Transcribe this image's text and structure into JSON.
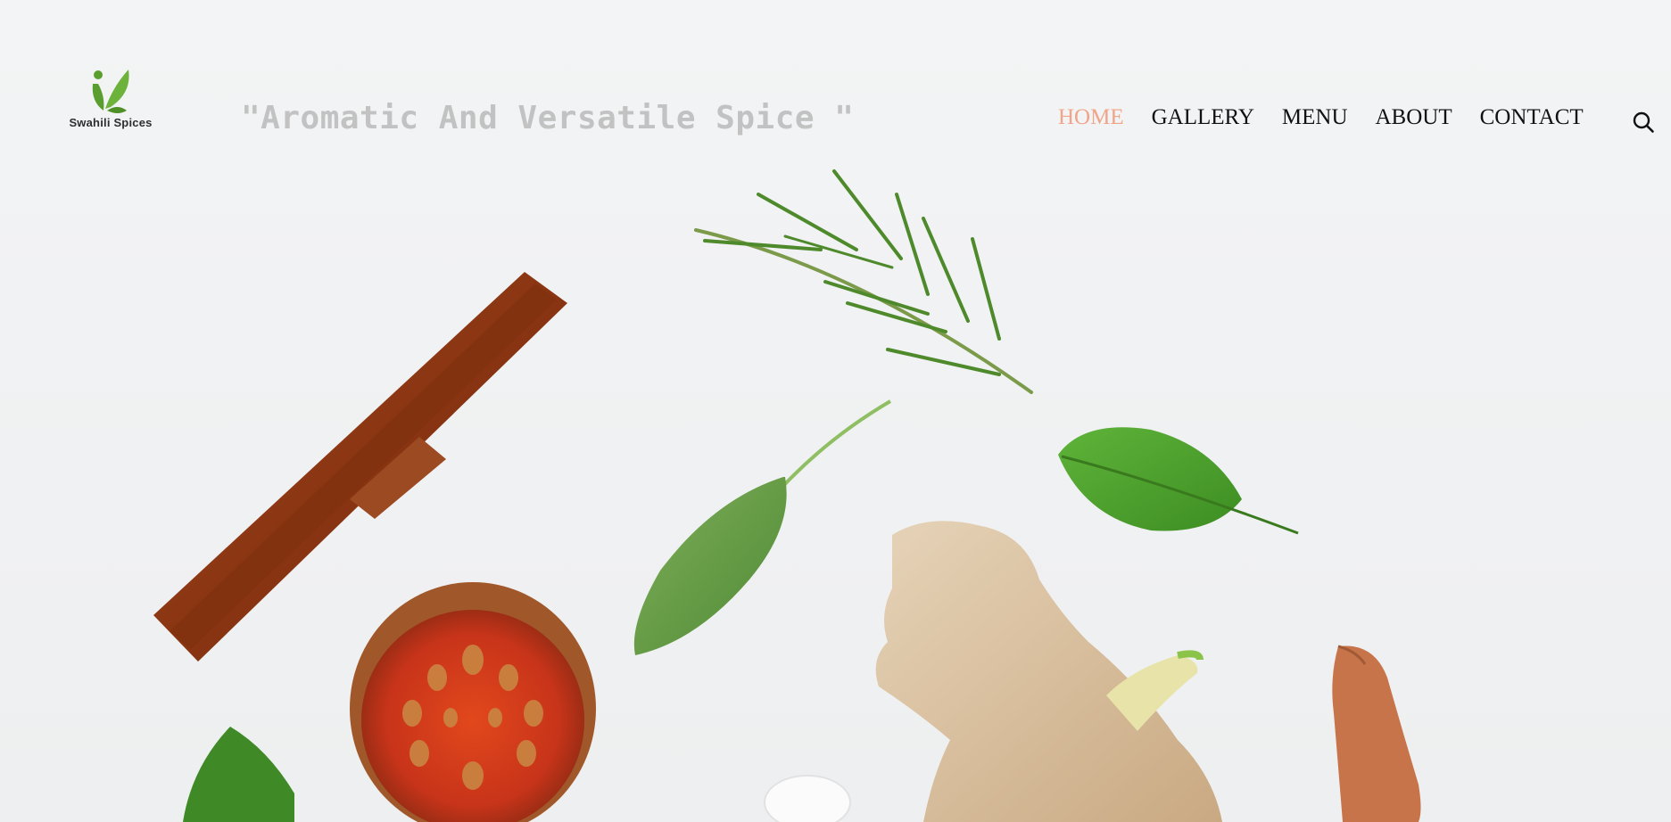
{
  "brand": {
    "name": "Swahili Spices",
    "logo_icon": "leaf-logo-icon",
    "logo_color": "#5a9e2f"
  },
  "hero": {
    "tagline": "\"Aromatic And Versatile Spice \"",
    "image_subject": "spices-and-herbs-photo"
  },
  "nav": {
    "items": [
      {
        "label": "HOME",
        "active": true
      },
      {
        "label": "GALLERY",
        "active": false
      },
      {
        "label": "MENU",
        "active": false
      },
      {
        "label": "ABOUT",
        "active": false
      },
      {
        "label": "CONTACT",
        "active": false
      }
    ],
    "active_color": "#f0a48a",
    "search_icon": "search-icon"
  }
}
